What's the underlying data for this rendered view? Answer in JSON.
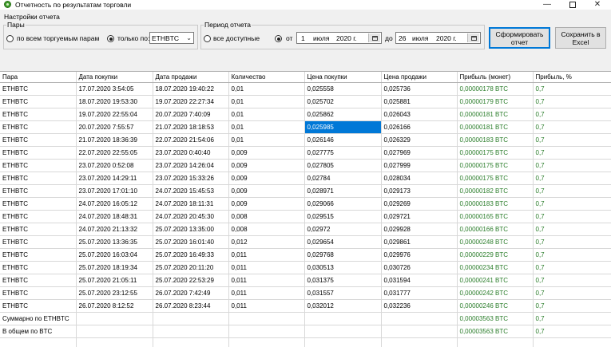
{
  "window": {
    "title": "Отчетность по результатам торговли",
    "minimize": "—",
    "close": "✕"
  },
  "settings": {
    "label": "Настройки отчета",
    "pairs": {
      "title": "Пары",
      "option_all": "по всем торгуемым парам",
      "option_only": "только по:",
      "selected_pair": "ETHBTC",
      "selected_option": "only"
    },
    "period": {
      "title": "Период отчета",
      "option_all": "все доступные",
      "from_label": "от",
      "to_label": "до",
      "selected_option": "range",
      "from": {
        "day": "1",
        "month": "июля",
        "year": "2020 г."
      },
      "to": {
        "day": "26",
        "month": "июля",
        "year": "2020 г."
      }
    },
    "buttons": {
      "generate": "Сформировать отчет",
      "excel": "Сохранить в Excel"
    }
  },
  "colors": {
    "profit_text": "#2a7d2a",
    "selection": "#0078d7"
  },
  "grid": {
    "columns": [
      "Пара",
      "Дата покупки",
      "Дата продажи",
      "Количество",
      "Цена покупки",
      "Цена продажи",
      "Прибыль (монет)",
      "Прибыль, %"
    ],
    "rows": [
      [
        "ETHBTC",
        "17.07.2020 3:54:05",
        "18.07.2020 19:40:22",
        "0,01",
        "0,025558",
        "0,025736",
        "0,00000178 BTC",
        "0,7"
      ],
      [
        "ETHBTC",
        "18.07.2020 19:53:30",
        "19.07.2020 22:27:34",
        "0,01",
        "0,025702",
        "0,025881",
        "0,00000179 BTC",
        "0,7"
      ],
      [
        "ETHBTC",
        "19.07.2020 22:55:04",
        "20.07.2020 7:40:09",
        "0,01",
        "0,025862",
        "0,026043",
        "0,00000181 BTC",
        "0,7"
      ],
      [
        "ETHBTC",
        "20.07.2020 7:55:57",
        "21.07.2020 18:18:53",
        "0,01",
        "0,025985",
        "0,026166",
        "0,00000181 BTC",
        "0,7"
      ],
      [
        "ETHBTC",
        "21.07.2020 18:36:39",
        "22.07.2020 21:54:06",
        "0,01",
        "0,026146",
        "0,026329",
        "0,00000183 BTC",
        "0,7"
      ],
      [
        "ETHBTC",
        "22.07.2020 22:55:05",
        "23.07.2020 0:40:40",
        "0,009",
        "0,027775",
        "0,027969",
        "0,00000175 BTC",
        "0,7"
      ],
      [
        "ETHBTC",
        "23.07.2020 0:52:08",
        "23.07.2020 14:26:04",
        "0,009",
        "0,027805",
        "0,027999",
        "0,00000175 BTC",
        "0,7"
      ],
      [
        "ETHBTC",
        "23.07.2020 14:29:11",
        "23.07.2020 15:33:26",
        "0,009",
        "0,02784",
        "0,028034",
        "0,00000175 BTC",
        "0,7"
      ],
      [
        "ETHBTC",
        "23.07.2020 17:01:10",
        "24.07.2020 15:45:53",
        "0,009",
        "0,028971",
        "0,029173",
        "0,00000182 BTC",
        "0,7"
      ],
      [
        "ETHBTC",
        "24.07.2020 16:05:12",
        "24.07.2020 18:11:31",
        "0,009",
        "0,029066",
        "0,029269",
        "0,00000183 BTC",
        "0,7"
      ],
      [
        "ETHBTC",
        "24.07.2020 18:48:31",
        "24.07.2020 20:45:30",
        "0,008",
        "0,029515",
        "0,029721",
        "0,00000165 BTC",
        "0,7"
      ],
      [
        "ETHBTC",
        "24.07.2020 21:13:32",
        "25.07.2020 13:35:00",
        "0,008",
        "0,02972",
        "0,029928",
        "0,00000166 BTC",
        "0,7"
      ],
      [
        "ETHBTC",
        "25.07.2020 13:36:35",
        "25.07.2020 16:01:40",
        "0,012",
        "0,029654",
        "0,029861",
        "0,00000248 BTC",
        "0,7"
      ],
      [
        "ETHBTC",
        "25.07.2020 16:03:04",
        "25.07.2020 16:49:33",
        "0,011",
        "0,029768",
        "0,029976",
        "0,00000229 BTC",
        "0,7"
      ],
      [
        "ETHBTC",
        "25.07.2020 18:19:34",
        "25.07.2020 20:11:20",
        "0,011",
        "0,030513",
        "0,030726",
        "0,00000234 BTC",
        "0,7"
      ],
      [
        "ETHBTC",
        "25.07.2020 21:05:11",
        "25.07.2020 22:53:29",
        "0,011",
        "0,031375",
        "0,031594",
        "0,00000241 BTC",
        "0,7"
      ],
      [
        "ETHBTC",
        "25.07.2020 23:12:55",
        "26.07.2020 7:42:49",
        "0,011",
        "0,031557",
        "0,031777",
        "0,00000242 BTC",
        "0,7"
      ],
      [
        "ETHBTC",
        "26.07.2020 8:12:52",
        "26.07.2020 8:23:44",
        "0,011",
        "0,032012",
        "0,032236",
        "0,00000246 BTC",
        "0,7"
      ],
      [
        "Суммарно по ETHBTC",
        "",
        "",
        "",
        "",
        "",
        "0,00003563 BTC",
        "0,7"
      ],
      [
        "В общем по BTC",
        "",
        "",
        "",
        "",
        "",
        "0,00003563 BTC",
        "0,7"
      ],
      [
        "",
        "",
        "",
        "",
        "",
        "",
        "",
        ""
      ]
    ],
    "selected_cell": {
      "row": 3,
      "col": 4
    }
  }
}
